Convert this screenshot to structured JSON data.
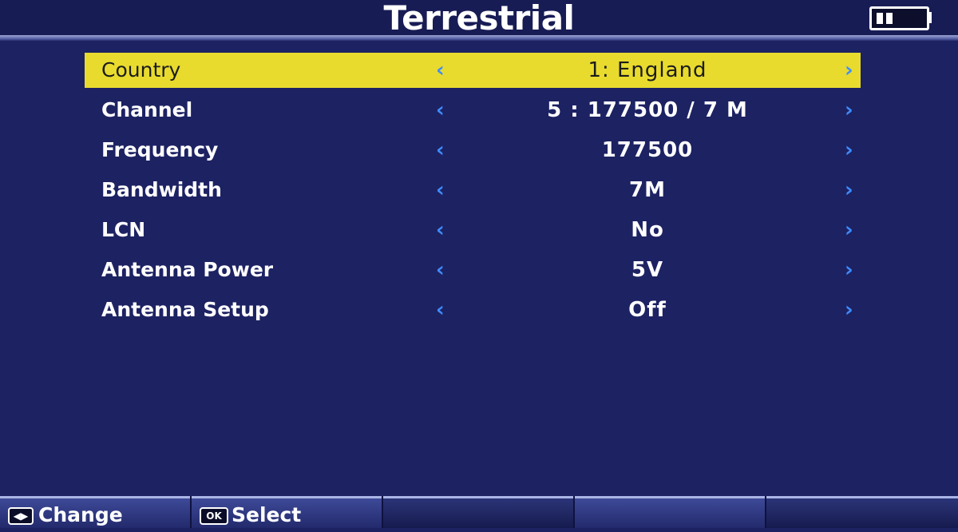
{
  "header": {
    "title": "Terrestrial",
    "battery_icon": "battery-icon"
  },
  "menu": {
    "selected_index": 0,
    "left_arrow": "‹",
    "right_arrow": "›",
    "rows": [
      {
        "label": "Country",
        "value": "1: England"
      },
      {
        "label": "Channel",
        "value": "5 : 177500 / 7 M"
      },
      {
        "label": "Frequency",
        "value": "177500"
      },
      {
        "label": "Bandwidth",
        "value": "7M"
      },
      {
        "label": "LCN",
        "value": "No"
      },
      {
        "label": "Antenna Power",
        "value": "5V"
      },
      {
        "label": "Antenna Setup",
        "value": "Off"
      }
    ]
  },
  "footer": {
    "change_icon": "◀▶",
    "change_label": "Change",
    "ok_icon": "OK",
    "select_label": "Select"
  },
  "colors": {
    "background": "#1d2263",
    "highlight": "#e8db2e",
    "arrow": "#3f8cff"
  }
}
